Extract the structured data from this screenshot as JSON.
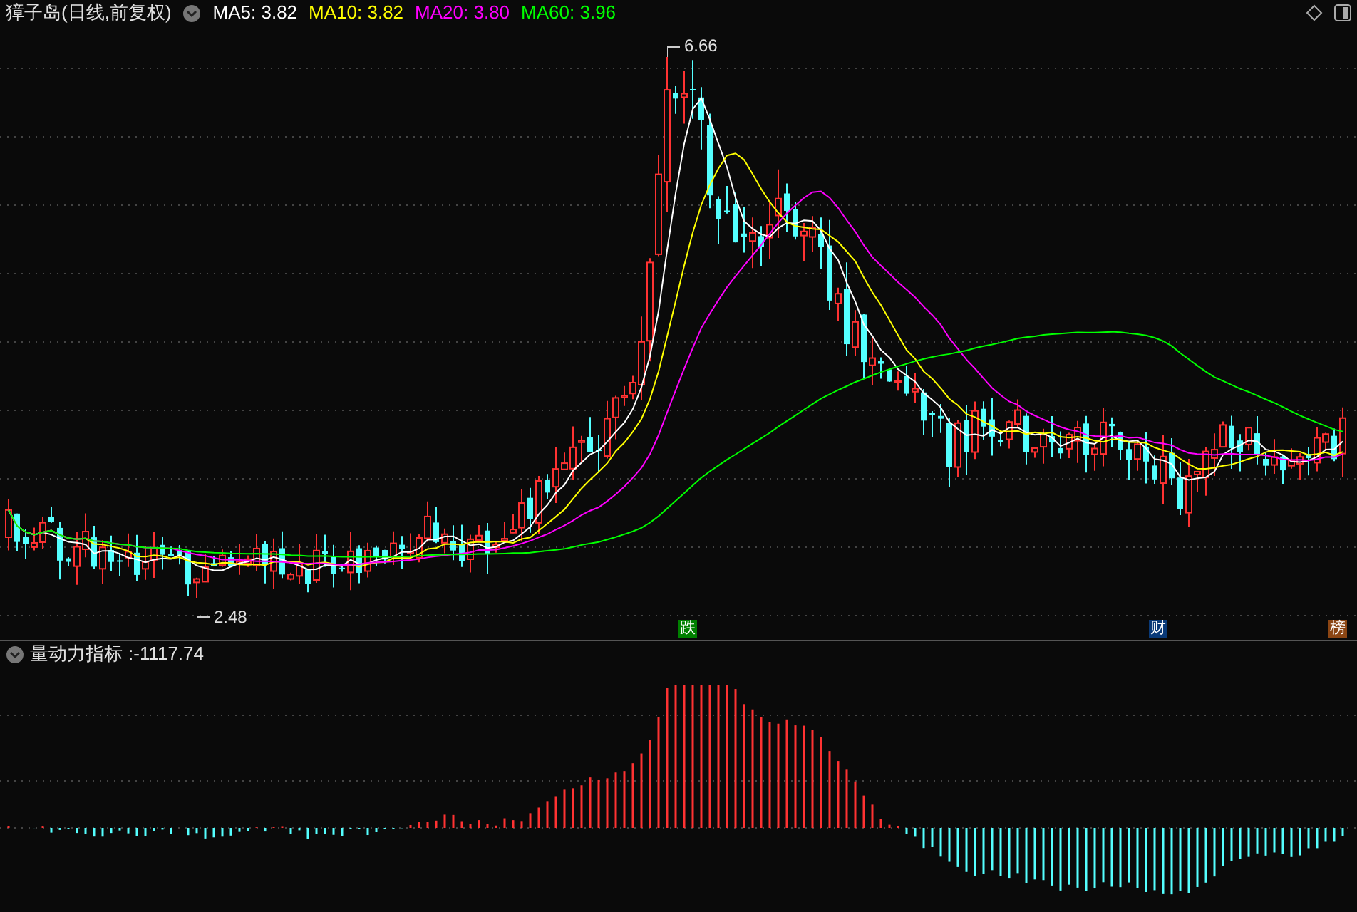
{
  "header": {
    "title": "獐子岛(日线,前复权)",
    "indicators": [
      {
        "label": "MA5: 3.82",
        "color": "#ffffff"
      },
      {
        "label": "MA10: 3.82",
        "color": "#ffff00"
      },
      {
        "label": "MA20: 3.80",
        "color": "#ff00ff"
      },
      {
        "label": "MA60: 3.96",
        "color": "#00ff00"
      }
    ]
  },
  "price_chart": {
    "high_label": "6.66",
    "low_label": "2.48",
    "events": [
      {
        "label": "跌",
        "color": "#008000"
      },
      {
        "label": "财",
        "color": "#0a3a78"
      },
      {
        "label": "榜",
        "color": "#8b4513"
      }
    ]
  },
  "indicator_pane": {
    "title": "量动力指标",
    "reading": ":-1117.74"
  }
}
